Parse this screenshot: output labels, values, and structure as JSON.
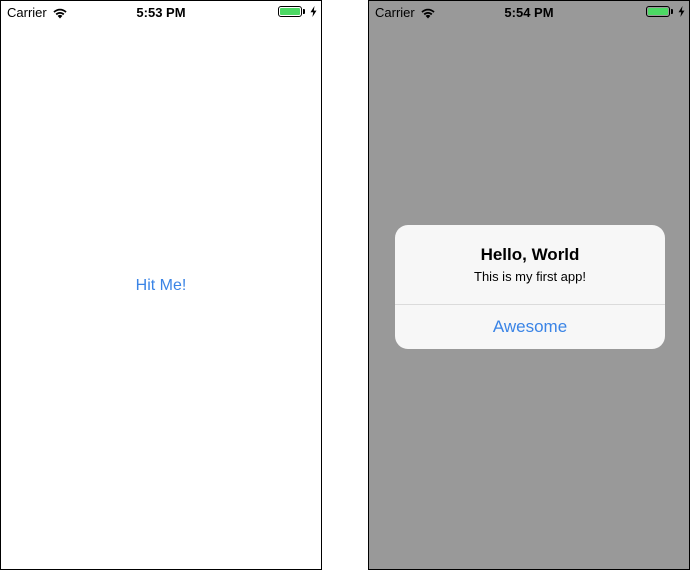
{
  "colors": {
    "tint": "#3a84e6",
    "battery": "#4cd964",
    "dim_background": "#999999"
  },
  "screens": [
    {
      "status_bar": {
        "carrier": "Carrier",
        "time": "5:53 PM",
        "wifi_icon": "wifi-icon",
        "battery_icon": "battery-charging-icon"
      },
      "button_label": "Hit Me!"
    },
    {
      "status_bar": {
        "carrier": "Carrier",
        "time": "5:54 PM",
        "wifi_icon": "wifi-icon",
        "battery_icon": "battery-charging-icon"
      },
      "alert": {
        "title": "Hello, World",
        "message": "This is my first app!",
        "action_label": "Awesome"
      }
    }
  ]
}
